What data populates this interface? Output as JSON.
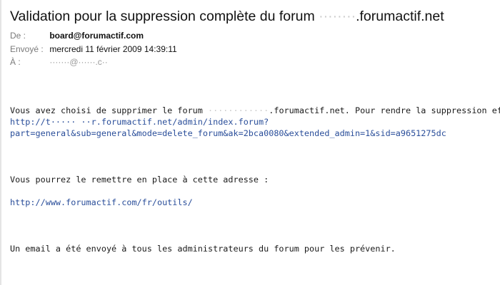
{
  "email": {
    "subject_prefix": "Validation pour la suppression complète du forum ",
    "subject_redacted": "········",
    "subject_suffix": ".forumactif.net",
    "from_label": "De :",
    "from_value": "board@forumactif.com",
    "sent_label": "Envoyé :",
    "sent_value": "mercredi 11 février 2009 14:39:11",
    "to_label": "À :",
    "to_value": "·······@······.c··"
  },
  "body": {
    "line1_prefix": "Vous avez choisi de supprimer le forum ",
    "line1_redacted": "············",
    "line1_suffix": ".forumactif.net. Pour rendre la suppression effective, cliquez sur le lien suivant :",
    "link1_part1": "http://t····· ··r.forumactif.net/admin/index.forum?",
    "link1_part2": "part=general&sub=general&mode=delete_forum&ak=2bca0080&extended_admin=1&sid=a9651275dc",
    "line2": "Vous pourrez le remettre en place à cette adresse :",
    "link2": "http://www.forumactif.com/fr/outils/",
    "line3": "Un email a été envoyé à tous les administrateurs du forum pour les prévenir."
  },
  "colors": {
    "link": "#2a4e9a",
    "label": "#7a7a7a",
    "text": "#111111"
  }
}
